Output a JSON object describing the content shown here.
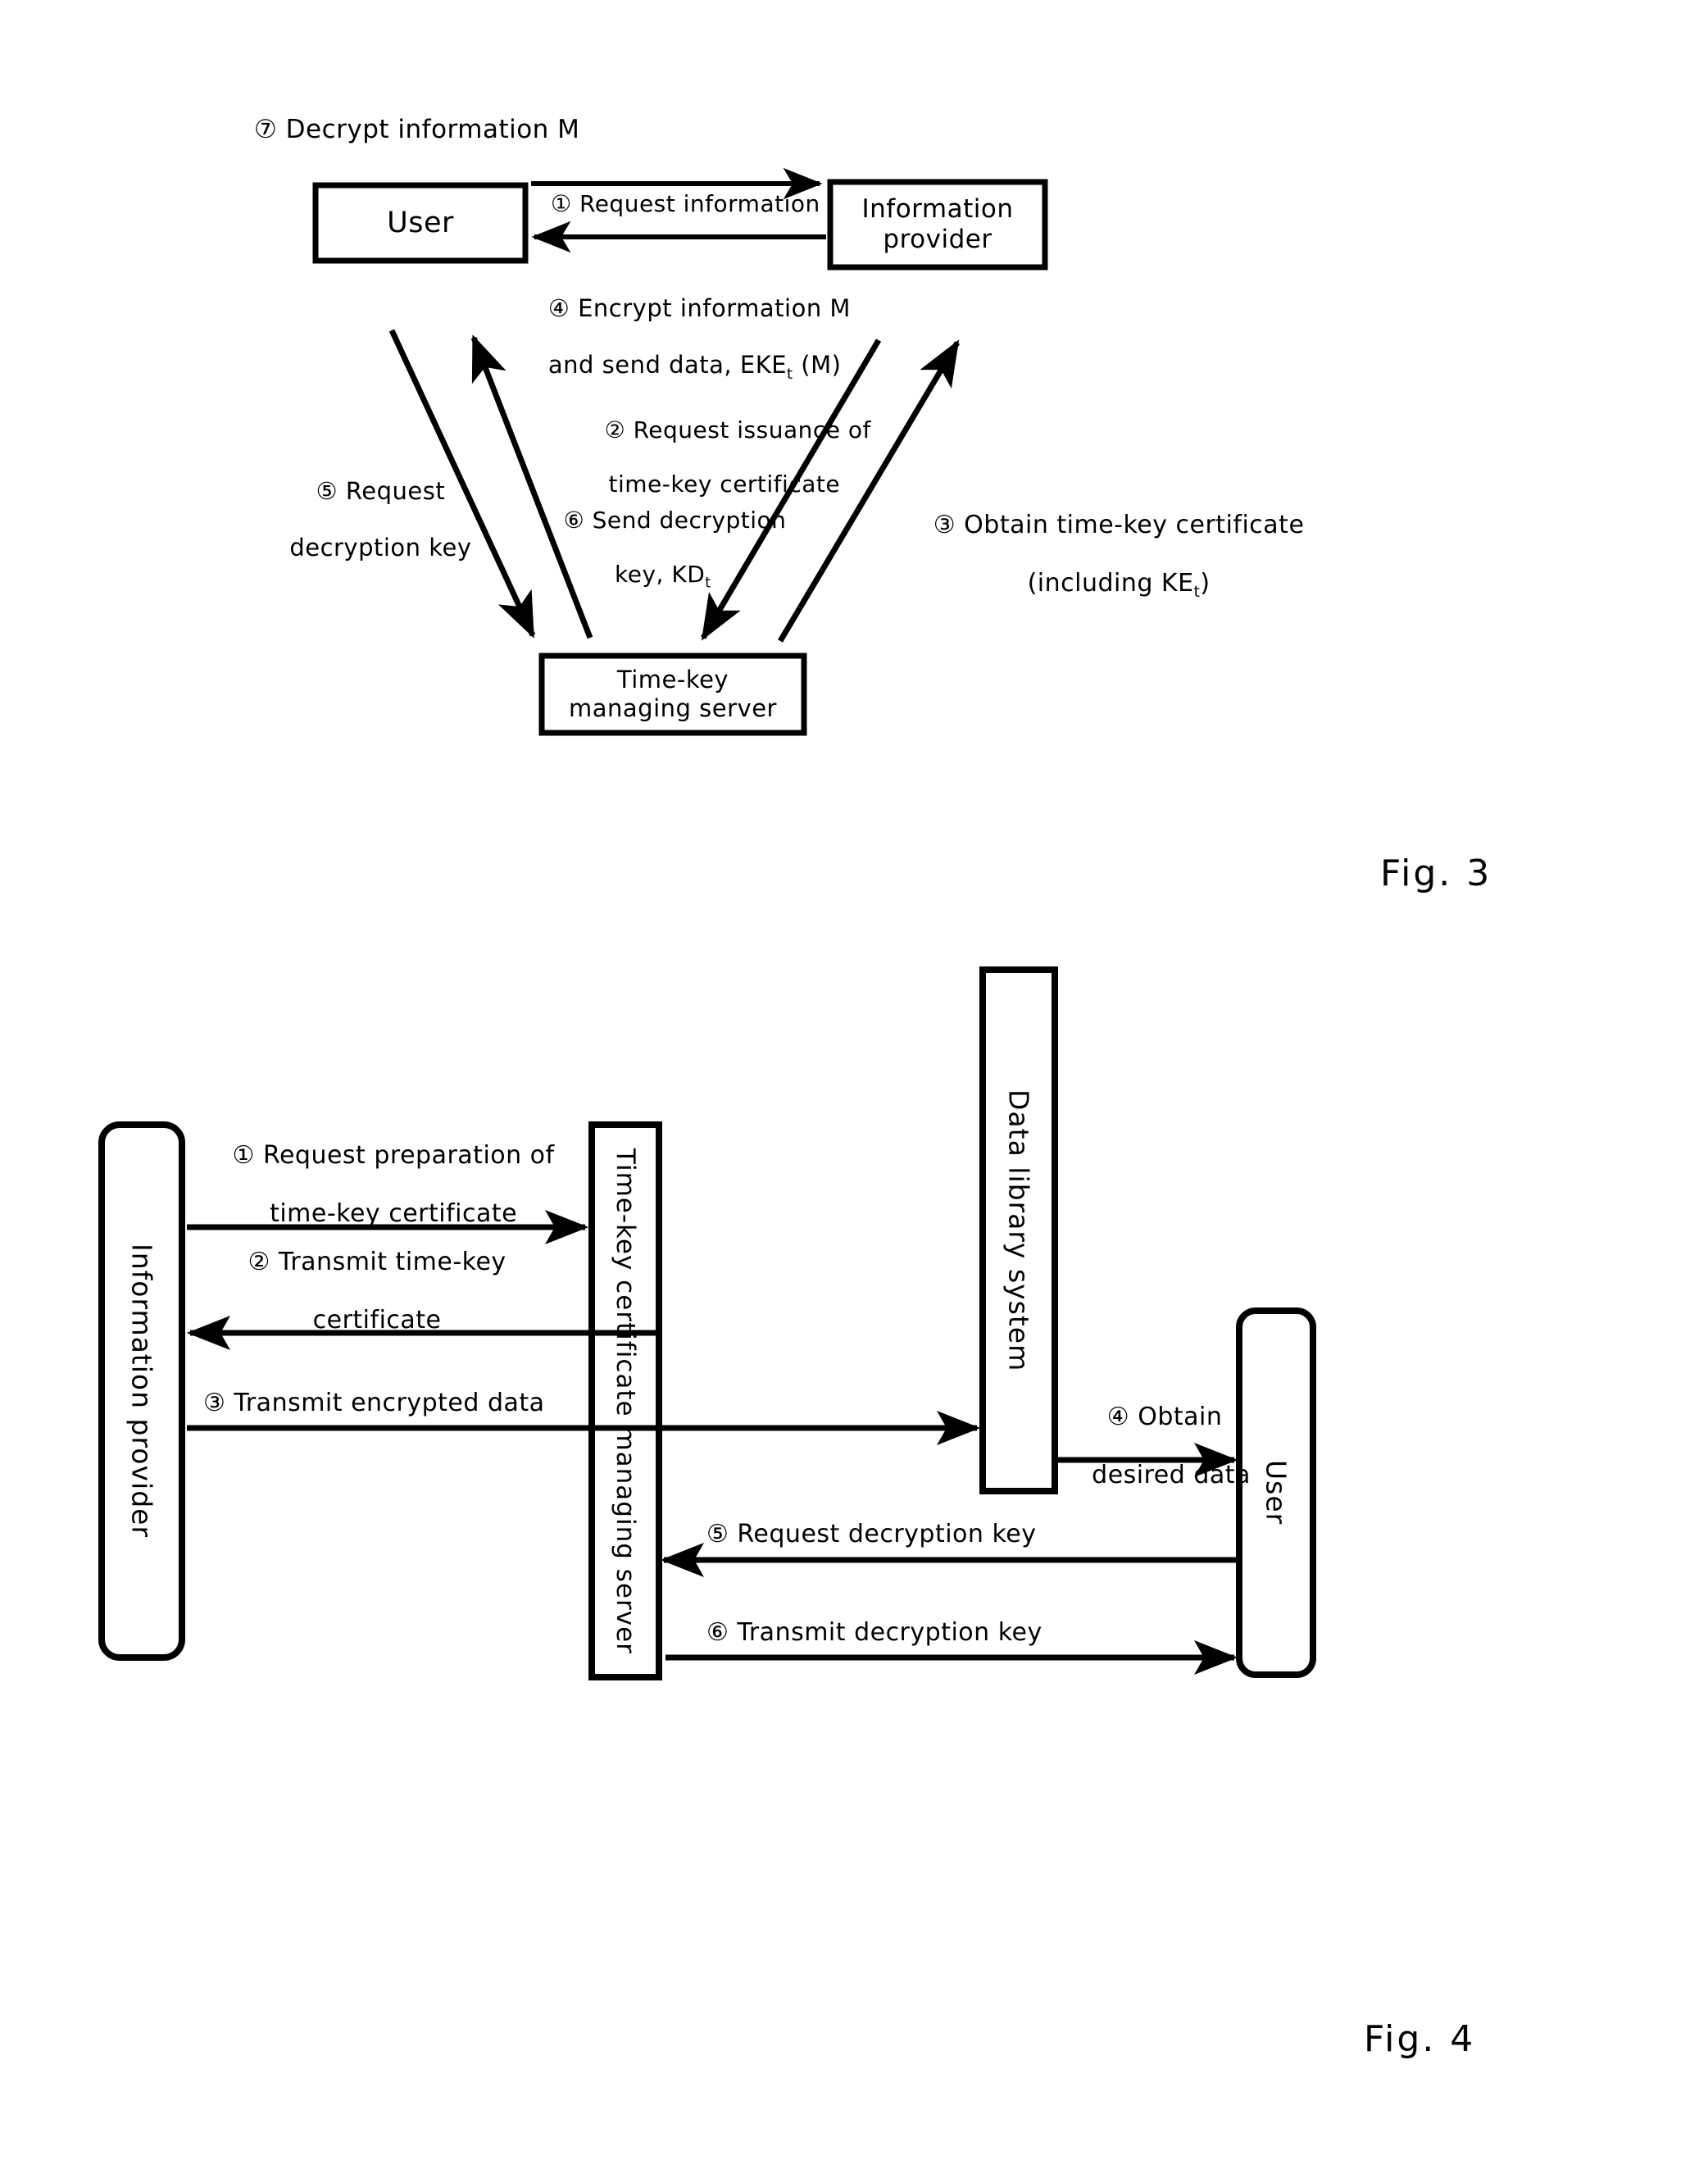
{
  "document": {
    "type": "patent-figure-sheet",
    "figures": [
      "Fig. 3",
      "Fig. 4"
    ]
  },
  "fig3": {
    "caption": "Fig. 3",
    "note7": "⑦ Decrypt information M",
    "boxes": {
      "user": "User",
      "provider_line1": "Information",
      "provider_line2": "provider",
      "server_line1": "Time-key",
      "server_line2": "managing server"
    },
    "arrows": {
      "a1": "① Request information",
      "a4_line1": "④ Encrypt information M",
      "a4_line2": "and send data, EKE",
      "a4_sub": "t",
      "a4_line2_tail": " (M)",
      "a2_line1": "② Request issuance of",
      "a2_line2": "time-key certificate",
      "a5_line1": "⑤ Request",
      "a5_line2": "decryption key",
      "a6_line1": "⑥ Send decryption",
      "a6_line2": "key, KD",
      "a6_sub": "t",
      "a3_line1": "③ Obtain time-key certificate",
      "a3_line2_pre": "(including KE",
      "a3_sub": "t",
      "a3_line2_post": ")"
    }
  },
  "fig4": {
    "caption": "Fig. 4",
    "boxes": {
      "provider": "Information provider",
      "server": "Time-key certificate managing server",
      "library": "Data library system",
      "user": "User"
    },
    "arrows": {
      "s1_line1": "① Request preparation of",
      "s1_line2": "time-key certificate",
      "s2_line1": "② Transmit time-key",
      "s2_line2": "certificate",
      "s3": "③ Transmit encrypted data",
      "s4_line1": "④ Obtain",
      "s4_line2": "desired data",
      "s5": "⑤ Request decryption key",
      "s6": "⑥ Transmit decryption key"
    }
  },
  "colors": {
    "ink": "#000000",
    "paper": "#ffffff"
  }
}
